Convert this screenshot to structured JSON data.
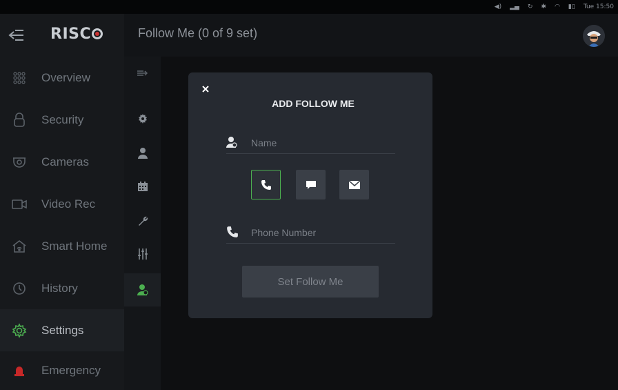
{
  "status_bar": {
    "time": "Tue 15:50"
  },
  "header": {
    "logo_text": "RISC",
    "page_title": "Follow Me (0 of 9 set)"
  },
  "sidebar": {
    "items": [
      {
        "label": "Overview",
        "icon": "grid-dots-icon",
        "active": false
      },
      {
        "label": "Security",
        "icon": "lock-icon",
        "active": false
      },
      {
        "label": "Cameras",
        "icon": "camera-icon",
        "active": false
      },
      {
        "label": "Video Rec",
        "icon": "video-camera-icon",
        "active": false
      },
      {
        "label": "Smart Home",
        "icon": "smart-home-icon",
        "active": false
      },
      {
        "label": "History",
        "icon": "history-icon",
        "active": false
      },
      {
        "label": "Settings",
        "icon": "gear-icon",
        "active": true
      },
      {
        "label": "Emergency",
        "icon": "alarm-icon",
        "active": false
      }
    ]
  },
  "rail": {
    "items": [
      {
        "icon": "expand-arrow-icon"
      },
      {
        "icon": "gear-icon"
      },
      {
        "icon": "user-icon"
      },
      {
        "icon": "calendar-icon"
      },
      {
        "icon": "wrench-icon"
      },
      {
        "icon": "sliders-icon"
      },
      {
        "icon": "follow-me-icon",
        "active": true
      }
    ]
  },
  "modal": {
    "title": "ADD FOLLOW ME",
    "name_placeholder": "Name",
    "phone_placeholder": "Phone Number",
    "methods": [
      {
        "icon": "phone-icon",
        "selected": true
      },
      {
        "icon": "message-icon",
        "selected": false
      },
      {
        "icon": "email-icon",
        "selected": false
      }
    ],
    "submit_label": "Set Follow Me"
  },
  "colors": {
    "accent_green": "#4caf50",
    "alert_red": "#c62828",
    "modal_bg": "#262a31"
  }
}
